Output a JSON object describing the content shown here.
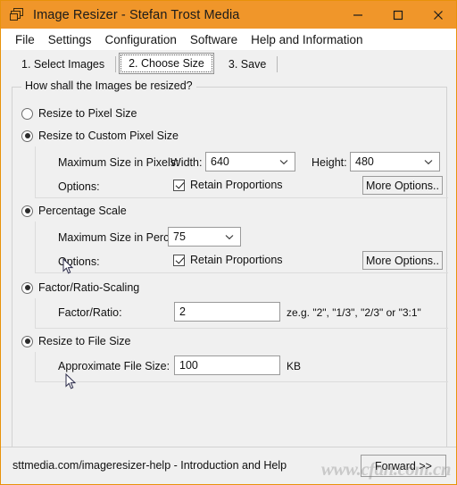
{
  "window": {
    "title": "Image Resizer - Stefan Trost Media",
    "icon": "cascade-windows-icon",
    "accent_color": "#f0962a",
    "controls": {
      "minimize": "minimize-icon",
      "maximize": "maximize-icon",
      "close": "close-icon"
    }
  },
  "menu": {
    "items": [
      {
        "label": "File"
      },
      {
        "label": "Settings"
      },
      {
        "label": "Configuration"
      },
      {
        "label": "Software"
      },
      {
        "label": "Help and Information"
      }
    ]
  },
  "tabs": {
    "items": [
      {
        "label": "1. Select Images",
        "active": false
      },
      {
        "label": "2. Choose Size",
        "active": true
      },
      {
        "label": "3. Save",
        "active": false
      }
    ]
  },
  "group": {
    "title": "How shall the Images be resized?"
  },
  "options": {
    "pixel_size": {
      "label": "Resize to Pixel Size",
      "selected": false
    },
    "custom_pixel_size": {
      "label": "Resize to Custom Pixel Size",
      "selected": true,
      "max_size_label": "Maximum Size in Pixels:",
      "width_label": "Width:",
      "width_value": "640",
      "height_label": "Height:",
      "height_value": "480",
      "options_label": "Options:",
      "retain_label": "Retain Proportions",
      "retain_checked": true,
      "more_options_label": "More Options.."
    },
    "percentage_scale": {
      "label": "Percentage Scale",
      "selected": true,
      "max_percent_label": "Maximum Size in Percent:",
      "percent_value": "75",
      "options_label": "Options:",
      "retain_label": "Retain Proportions",
      "retain_checked": true,
      "more_options_label": "More Options.."
    },
    "factor_ratio": {
      "label": "Factor/Ratio-Scaling",
      "selected": true,
      "field_label": "Factor/Ratio:",
      "value": "2",
      "hint": "ze.g. \"2\", \"1/3\", \"2/3\" or \"3:1\""
    },
    "file_size": {
      "label": "Resize to File Size",
      "selected": true,
      "field_label": "Approximate File Size:",
      "value": "100",
      "unit": "KB"
    }
  },
  "statusbar": {
    "text": "sttmedia.com/imageresizer-help - Introduction and Help",
    "forward_label": "Forward >>"
  },
  "watermark": {
    "text": "www.cfan.com.cn"
  }
}
